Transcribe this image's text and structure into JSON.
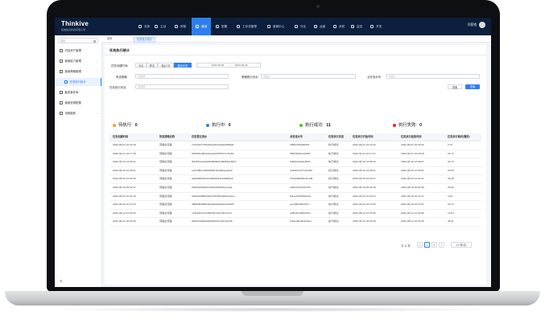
{
  "brand": {
    "name": "Thinkive",
    "subtitle": "思迪信息科技有限公司"
  },
  "topnav": {
    "items": [
      {
        "label": "总体"
      },
      {
        "label": "主动"
      },
      {
        "label": "审核"
      },
      {
        "label": "营销"
      },
      {
        "label": "配置"
      },
      {
        "label": "工作流管理"
      },
      {
        "label": "营销中心"
      },
      {
        "label": "作业"
      },
      {
        "label": "运营"
      },
      {
        "label": "系统"
      },
      {
        "label": "监控"
      },
      {
        "label": "开发"
      }
    ],
    "active_index": 3,
    "user": "问营销"
  },
  "sidebar": {
    "search_placeholder": "搜索",
    "items": [
      {
        "label": "内容资产管理"
      },
      {
        "label": "营销能力管理"
      },
      {
        "label": "营销策略管理"
      },
      {
        "label": "任务执行统计"
      },
      {
        "label": "触发事件库"
      },
      {
        "label": "营销资源配置"
      },
      {
        "label": "流程模型"
      }
    ],
    "active_index": 3,
    "footer_icon": "collapse-icon"
  },
  "tabs": [
    {
      "label": "首页"
    },
    {
      "label": "任务执行统计"
    }
  ],
  "card": {
    "title": "任务执行统计"
  },
  "filters": {
    "time_label": "任务创建时间:",
    "time_options": [
      "今天",
      "昨天",
      "最近7天",
      "最近30天"
    ],
    "time_active": 3,
    "date_start": "2022-09-03",
    "date_sep": "~",
    "date_end": "2022-09-02",
    "strategy_label": "所选策略:",
    "strategy_placeholder": "请选择",
    "record_label": "策略登记流水:",
    "record_placeholder": "请输入",
    "serial_label": "业务流水号:",
    "serial_placeholder": "请输入",
    "status_label": "任务执行状态:",
    "status_placeholder": "请选择",
    "reset_label": "重置",
    "query_label": "查询"
  },
  "stats": [
    {
      "label": "待执行:",
      "value": "0",
      "color": "#f5a623"
    },
    {
      "label": "执行中:",
      "value": "0",
      "color": "#2d7ff0"
    },
    {
      "label": "执行成功:",
      "value": "11",
      "color": "#52c41a"
    },
    {
      "label": "执行失败:",
      "value": "0",
      "color": "#f5222d"
    }
  ],
  "table": {
    "columns": [
      "任务创建时间",
      "所选策略名称",
      "任务登记流水",
      "业务流水号",
      "任务执行状态",
      "任务执行开始时间",
      "任务执行结束时间",
      "任务执行耗时(毫秒)"
    ],
    "rows": [
      [
        "2022-09-01 16:22:18",
        "营销全流程",
        "71d4c9d7758e9f0ea91bd5a2d5908a0",
        "695f2d793d8b45f...",
        "执行成功",
        "2022-09-01 16:22:22",
        "2022-09-01 16:22:26",
        "3.75"
      ],
      [
        "2022-09-01 16:17:48",
        "营销全流程",
        "5824651d8b324eb2ab87f9371c7318d",
        "05f03933fc143487...",
        "执行成功",
        "2022-09-01 16:17:47",
        "2022-09-01 16:18:18",
        "29.72"
      ],
      [
        "2022-08-19 13:09:41",
        "营销全流程",
        "f621907ac2ab4903830b9e0986b4c8037",
        "bd942c0e0de8247...",
        "执行成功",
        "2022-08-19 13:08:43",
        "2022-08-19 13:09:07",
        "26.72"
      ],
      [
        "2022-08-19 12:05:21",
        "营销全流程",
        "ed1798b1796b0983011b98e6eda42f",
        "4e951bc0c77ad439...",
        "执行成功",
        "2022-08-19 12:05:21",
        "2022-08-19 12:05:52",
        "30.50"
      ],
      [
        "2022-08-19 12:03:46",
        "营销全流程",
        "a8ad03803d4cbd382833de9199b5a5",
        "7bf19d9b8d5c1b4d8...",
        "执行成功",
        "2022-08-19 12:03:47",
        "2022-08-19 12:04:21",
        "35.38"
      ],
      [
        "2022-08-19 09:02:11",
        "营销全流程",
        "9395de0983d4cd9b6018f8f2acf1ea9",
        "1a5b2c5bca53780...",
        "执行成功",
        "2022-08-19 09:02:38",
        "2022-08-19 09:02:38",
        "26.60"
      ],
      [
        "2022-08-19 16:24:19",
        "营销全流程",
        "d49de628803348e7f55b5d22b613acce",
        "f01ae0c8b36f41dd...",
        "执行成功",
        "2022-08-19 16:24:22",
        "2022-08-19 16:24:27",
        "4.99"
      ],
      [
        "2022-08-18 16:12:10",
        "营销全流程",
        "d8f58d0d5f90d43e8d9252a8eb4428f3",
        "aec4f6b30847bf7...",
        "执行成功",
        "2022-08-18 16:12:50",
        "2022-08-18 16:12:51",
        "29.73"
      ],
      [
        "2022-08-12 21:52:03",
        "营销全流程",
        "7e6a1fba37215f0bd0141b76b7ccb4",
        "ad6f4bce9f0b4197...",
        "执行成功",
        "2022-08-12 21:52:05",
        "2022-08-12 21:52:38",
        "13.64"
      ],
      [
        "2022-08-12 16:23:40",
        "营销全流程",
        "9b56ac38e8a32840007de3f17a4138",
        "fe32ed8ed81bd1ba...",
        "执行成功",
        "2022-08-12 16:23:40",
        "2022-08-12 16:24:28",
        "35.41"
      ]
    ]
  },
  "pagination": {
    "total_text": "共 11 条",
    "prev_symbol": "<",
    "pages": [
      "1",
      "2"
    ],
    "current_page": "1",
    "next_symbol": ">",
    "page_size": "10 条/页"
  }
}
